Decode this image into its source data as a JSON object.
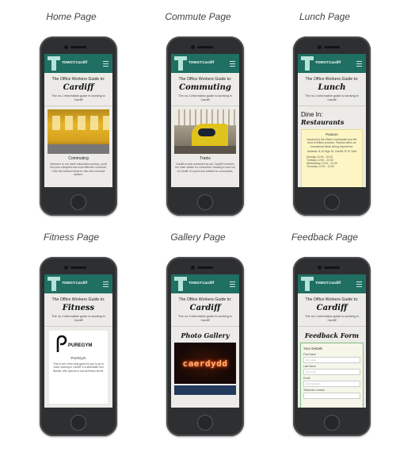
{
  "brand": "TOWGT:Cardiff",
  "pages": [
    {
      "caption": "Home Page",
      "t1": "The Office Workers Guide to:",
      "t2": "Cardiff",
      "t3": "The no.1 information guide to working in Cardiff",
      "card_title": "Commuting",
      "card_body": "Welcome to our travel information section, you'll find your cheapest and most effective commute. Click the buttons below to view the commute options."
    },
    {
      "caption": "Commute Page",
      "t1": "The Office Workers Guide to:",
      "t2": "Commuting",
      "t3": "The no.1 information guide to working in Cardiff",
      "card_title": "Trains",
      "card_body": "Cardiff is well connected by rail. Cardiff Central is the main station for commuters heading in and out of Cardiff. It's quick and reliable for commuters."
    },
    {
      "caption": "Lunch Page",
      "t1": "The Office Workers Guide to:",
      "t2": "Lunch",
      "t3": "The no.1 information guide to working in Cardiff",
      "dine_in": "Dine In:",
      "dine_sub": "Restaurants",
      "venue": "Pasture",
      "venue_body": "Inspired by the Welsh countryside and the best of British produce, Pasture offers an exceptional steak dining experience.",
      "address": "Address: 8-10 High St, Cardiff CF10 1AW",
      "hours": [
        "Monday 12:00 - 22:30",
        "Tuesday 12:00 - 22:30",
        "Wednesday 12:00 - 22:30",
        "Thursday 12:00 - 22:30"
      ]
    },
    {
      "caption": "Fitness Page",
      "t1": "The Office Workers Guide to:",
      "t2": "Fitness",
      "t3": "The no.1 information guide to working in Cardiff",
      "gym_logo": "PUREGYM",
      "gym_name": "PureGym",
      "gym_body": "This is one of the best gyms for you to go to when working in Cardiff. It is affordable and flexible, with options to suit all fitness levels."
    },
    {
      "caption": "Gallery Page",
      "t1": "The Office Workers Guide to:",
      "t2": "Cardiff",
      "t3": "The no.1 information guide to working in Cardiff",
      "section": "Photo Gallery",
      "neon": "caerdydd"
    },
    {
      "caption": "Feedback Page",
      "t1": "The Office Workers Guide to:",
      "t2": "Cardiff",
      "t3": "The no.1 information guide to working in Cardiff",
      "section": "Feedback Form",
      "legend": "Your Details",
      "fields": [
        {
          "label": "First Name",
          "placeholder": "first name"
        },
        {
          "label": "Last Name",
          "placeholder": "last name"
        },
        {
          "label": "Email",
          "placeholder": "email address"
        },
        {
          "label": "Telephone number",
          "placeholder": ""
        }
      ]
    }
  ]
}
